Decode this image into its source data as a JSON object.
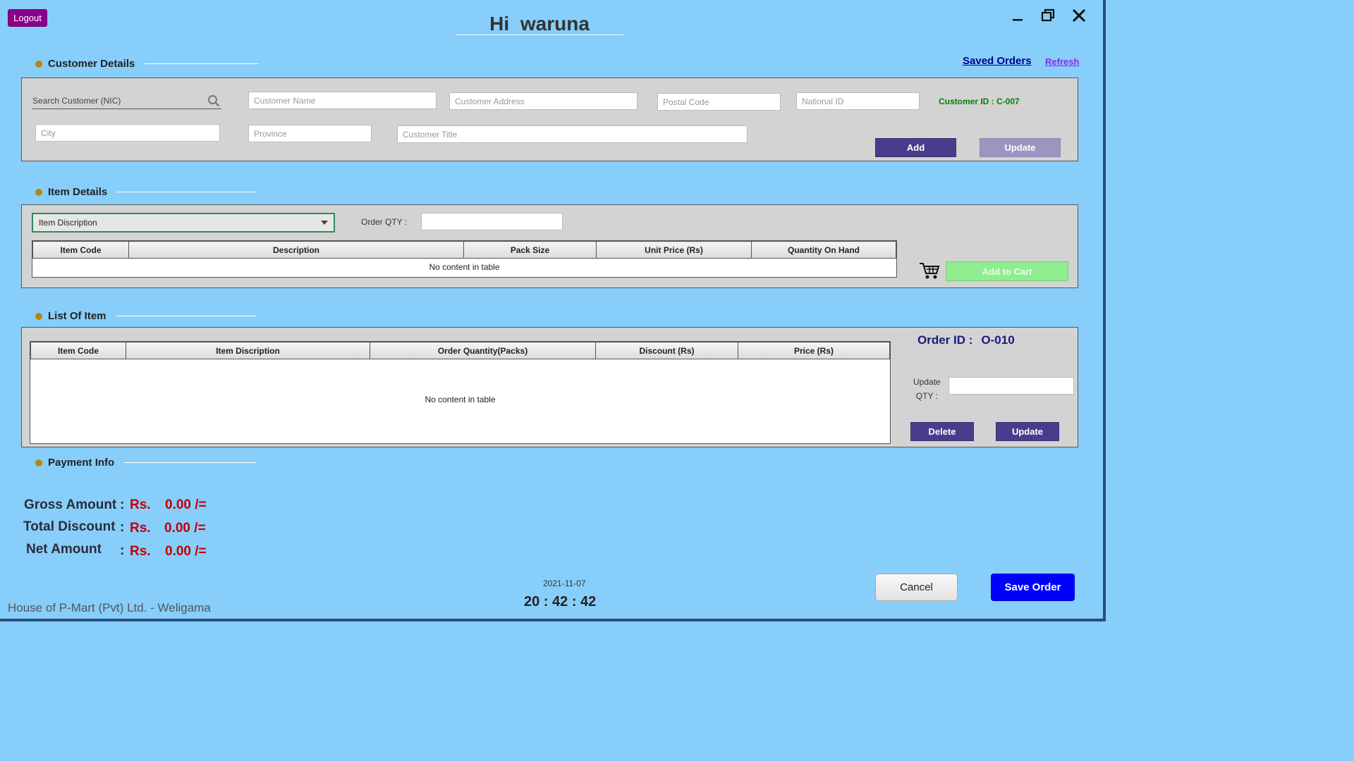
{
  "header": {
    "logout_label": "Logout",
    "greeting_hi": "Hi",
    "greeting_name": "waruna"
  },
  "customer": {
    "section_title": "Customer Details",
    "saved_orders_link": "Saved Orders",
    "refresh_link": "Refresh",
    "search_placeholder": "Search Customer (NIC)",
    "name_placeholder": "Customer Name",
    "address_placeholder": "Customer Address",
    "postal_placeholder": "Postal Code",
    "national_id_placeholder": "National ID",
    "customer_id_text": "Customer ID :  C-007",
    "city_placeholder": "City",
    "province_placeholder": "Province",
    "title_placeholder": "Customer Title",
    "add_label": "Add",
    "update_label": "Update"
  },
  "items": {
    "section_title": "Item Details",
    "item_select_value": "Item Discription",
    "order_qty_label": "Order QTY :",
    "columns": [
      "Item Code",
      "Description",
      "Pack Size",
      "Unit Price (Rs)",
      "Quantity On Hand"
    ],
    "empty_text": "No content in table",
    "add_to_cart_label": "Add to Cart"
  },
  "list": {
    "section_title": "List Of Item",
    "columns": [
      "Item Code",
      "Item Discription",
      "Order Quantity(Packs)",
      "Discount (Rs)",
      "Price (Rs)"
    ],
    "empty_text": "No content in table",
    "order_id_label": "Order ID :",
    "order_id_value": "O-010",
    "update_qty_label_1": "Update",
    "update_qty_label_2": "QTY :",
    "delete_label": "Delete",
    "update_label": "Update"
  },
  "payment": {
    "section_title": "Payment Info",
    "gross_label": "Gross Amount",
    "discount_label": "Total Discount",
    "net_label": "Net Amount",
    "colon": ":",
    "currency": "Rs.",
    "gross_value": "0.00 /=",
    "discount_value": "0.00 /=",
    "net_value": "0.00 /="
  },
  "footer": {
    "company": "House of P-Mart (Pvt) Ltd.  - Weligama",
    "date": "2021-11-07",
    "time": "20 : 42 : 42",
    "cancel_label": "Cancel",
    "save_order_label": "Save Order"
  },
  "colors": {
    "background": "#87cefa",
    "panel": "#d3d3d3",
    "primary_button": "#483d8b",
    "save_button": "#0000ff",
    "logout": "#8b008b",
    "amount": "#c00000",
    "customer_id": "#008000"
  },
  "icons": [
    "minimize-icon",
    "restore-icon",
    "close-icon",
    "search-icon",
    "dropdown-arrow-icon",
    "cart-icon"
  ]
}
